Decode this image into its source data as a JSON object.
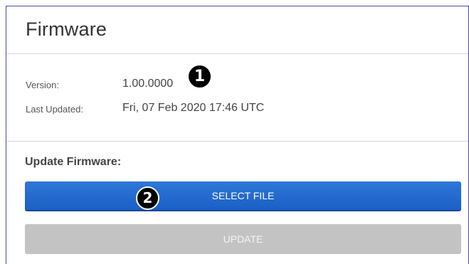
{
  "page": {
    "title": "Firmware"
  },
  "info": {
    "version_label": "Version:",
    "version_value": "1.00.0000",
    "updated_label": "Last Updated:",
    "updated_value": "Fri, 07 Feb 2020 17:46 UTC"
  },
  "update": {
    "heading": "Update Firmware:",
    "select_file_label": "SELECT FILE",
    "update_label": "UPDATE",
    "update_enabled": false
  },
  "callouts": {
    "first": "1",
    "second": "2"
  },
  "colors": {
    "primary_button": "#2a6fd6",
    "disabled_button": "#c3c3c3",
    "frame_border": "#4c4ca8"
  }
}
